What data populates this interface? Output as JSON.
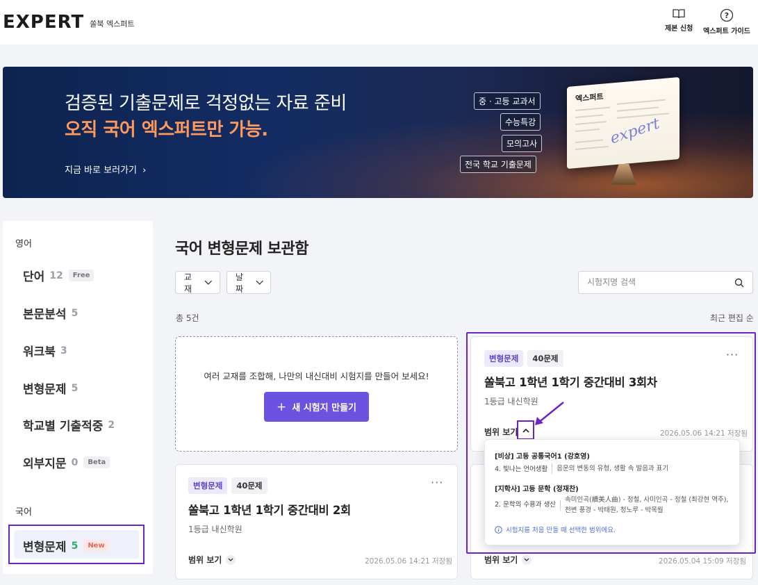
{
  "header": {
    "logo_text": "EXPERT",
    "logo_sub": "쏠북 엑스퍼트",
    "apply_label": "제본 신청",
    "guide_label": "엑스퍼트 가이드"
  },
  "banner": {
    "title_line1": "검증된 기출문제로 걱정없는 자료 준비",
    "title_line2": "오직 국어 엑스퍼트만 가능.",
    "link": "지금 바로 보러가기",
    "chips": [
      "중 · 고등 교과서",
      "수능특강",
      "모의고사",
      "전국 학교 기출문제"
    ],
    "monitor_title": "엑스퍼트",
    "monitor_sub": "expert"
  },
  "sidebar": {
    "section_english": "영어",
    "section_korean": "국어",
    "items": [
      {
        "label": "단어",
        "count": "12",
        "badge": "Free"
      },
      {
        "label": "본문분석",
        "count": "5"
      },
      {
        "label": "워크북",
        "count": "3"
      },
      {
        "label": "변형문제",
        "count": "5"
      },
      {
        "label": "학교별 기출적중",
        "count": "2"
      },
      {
        "label": "외부지문",
        "count": "0",
        "badge": "Beta"
      },
      {
        "label": "변형문제",
        "count": "5",
        "badge": "New"
      }
    ]
  },
  "main": {
    "title": "국어 변형문제 보관함",
    "filter_textbook": "교재",
    "filter_date": "날짜",
    "search_placeholder": "시험지명 검색",
    "total": "총 5건",
    "sort": "최근 편집 순",
    "new_card": {
      "text": "여러 교재를 조합해, 나만의 내신대비 시험지를 만들어 보세요!",
      "button": "새 시험지 만들기"
    },
    "cards": [
      {
        "tag": "변형문제",
        "count": "40문제",
        "title": "쏠북고 1학년 1학기 중간대비 3회차",
        "sub": "1등급 내신학원",
        "range": "범위 보기",
        "date": "2026.05.06 14:21 저장됨"
      },
      {
        "tag": "변형문제",
        "count": "40문제",
        "title": "쏠북고 1학년 1학기 중간대비 2회",
        "sub": "1등급 내신학원",
        "range": "범위 보기",
        "date": "2026.05.06 14:21 저장됨"
      },
      {
        "range": "범위 보기",
        "date": "2026.05.04 15:09 저장됨"
      }
    ],
    "popup": {
      "book1": "[비상] 고등 공통국어1 (강호영)",
      "book1_chapter": "4. 빛나는 언어생활",
      "book1_desc": "음운의 변동의 유형, 생활 속 발음과 표기",
      "book2": "[지학사] 고등 문학 (정재찬)",
      "book2_chapter": "2. 문학의 수용과 생산",
      "book2_desc": "속미인곡(續美人曲) - 정철, 사미인곡 - 정철 (최강현 역주), 천변 풍경 - 박태원, 청노루 - 박목월",
      "note": "시험지를 처음 만들 때 선택한 범위에요."
    }
  },
  "colors": {
    "accent": "#6c52e0",
    "highlight": "#6b22c6",
    "banner_orange": "#ff9a5a"
  }
}
